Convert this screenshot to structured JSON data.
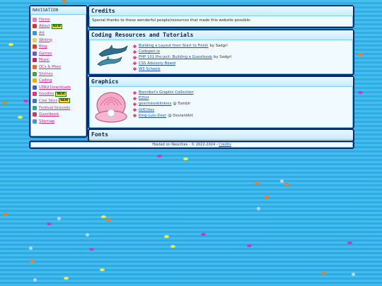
{
  "nav": {
    "title": "NAVIGATION",
    "items": [
      {
        "label": "Home",
        "icon": "home-icon",
        "color": "#e97abb"
      },
      {
        "label": "About",
        "icon": "about-icon",
        "color": "#c83a2a",
        "badge": "NEW"
      },
      {
        "label": "Art",
        "icon": "art-icon",
        "color": "#2f9ad8"
      },
      {
        "label": "Writing",
        "icon": "writing-icon",
        "color": "#e0d060"
      },
      {
        "label": "Blog",
        "icon": "blog-icon",
        "color": "#d04030"
      },
      {
        "label": "Games",
        "icon": "games-icon",
        "color": "#6a5ad0"
      },
      {
        "label": "Music",
        "icon": "music-icon",
        "color": "#b03060"
      },
      {
        "label": "OCs & More",
        "icon": "ocs-icon",
        "color": "#e06a30"
      },
      {
        "label": "Shrines",
        "icon": "shrines-icon",
        "color": "#4aa040"
      },
      {
        "label": "Coding",
        "icon": "coding-icon",
        "color": "#e0b020"
      },
      {
        "label": "UTAU Downloads",
        "icon": "utau-icon",
        "color": "#3a60c0"
      },
      {
        "label": "Goodies",
        "icon": "goodies-icon",
        "color": "#d04080",
        "badge": "NEW"
      },
      {
        "label": "Cool Sites",
        "icon": "cool-sites-icon",
        "color": "#4070d0",
        "badge": "NEW"
      },
      {
        "label": "Festival Grounds",
        "icon": "festival-icon",
        "color": "#30a0a0"
      },
      {
        "label": "Guestbook",
        "icon": "guestbook-icon",
        "color": "#c03a6a"
      },
      {
        "label": "Sitemap",
        "icon": "sitemap-icon",
        "color": "#4a90d0"
      }
    ]
  },
  "credits": {
    "title": "Credits",
    "text": "Special thanks to these wonderful people/resources that made this website possible:"
  },
  "coding": {
    "title": "Coding Resources and Tutorials",
    "items": [
      {
        "link": "Building a Layout from Start to Finish",
        "suffix": "by Sadgrl"
      },
      {
        "link": "Codepen.io",
        "suffix": ""
      },
      {
        "link": "PHP 101 Pro-ject: Building a Guestbook",
        "suffix": "by Sadgrl"
      },
      {
        "link": "CSS Advisory Board",
        "suffix": ""
      },
      {
        "link": "W3 Schools",
        "suffix": ""
      }
    ]
  },
  "graphics": {
    "title": "Graphics",
    "items": [
      {
        "link": "Bonnibel's Graphic Collection",
        "suffix": ""
      },
      {
        "link": "EZGif",
        "suffix": ""
      },
      {
        "link": "gesclistesblinkies",
        "suffix": "@ Tumblr"
      },
      {
        "link": "GifCities",
        "suffix": ""
      },
      {
        "link": "King-Lulu-Deer",
        "suffix": "@ DeviantArt"
      }
    ]
  },
  "fonts": {
    "title": "Fonts"
  },
  "footer": {
    "text": "Hosted on Neocities - © 2022-2024 -",
    "link": "Credits"
  }
}
